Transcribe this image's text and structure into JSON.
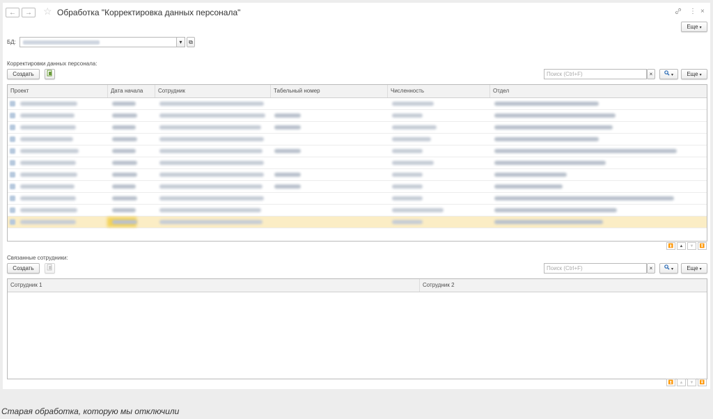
{
  "window": {
    "title": "Обработка \"Корректировка данных персонала\"",
    "back_glyph": "←",
    "forward_glyph": "→",
    "star_glyph": "☆",
    "link_glyph": "🔗",
    "menu_glyph": "⋮",
    "close_glyph": "×",
    "more_label": "Еще"
  },
  "db": {
    "label": "БД:",
    "dropdown_glyph": "▾",
    "open_glyph": "⧉"
  },
  "corrections": {
    "section_label": "Корректировки данных персонала:",
    "create_label": "Создать",
    "search_placeholder": "Поиск (Ctrl+F)",
    "clear_glyph": "×",
    "search_glyph": "🔍",
    "more_label": "Еще",
    "columns": [
      "Проект",
      "Дата начала",
      "Сотрудник",
      "Табельный номер",
      "Численность",
      "Отдел"
    ],
    "row_count": 11,
    "selected_row": 11
  },
  "related": {
    "section_label": "Связанные сотрудники:",
    "create_label": "Создать",
    "search_placeholder": "Поиск (Ctrl+F)",
    "clear_glyph": "×",
    "search_glyph": "🔍",
    "more_label": "Еще",
    "columns": [
      "Сотрудник 1",
      "Сотрудник 2"
    ]
  },
  "pager": {
    "first_glyph": "⏫",
    "prev_glyph": "▲",
    "next_glyph": "▼",
    "last_glyph": "⏬"
  },
  "caption": "Старая обработка, которую мы отключили"
}
